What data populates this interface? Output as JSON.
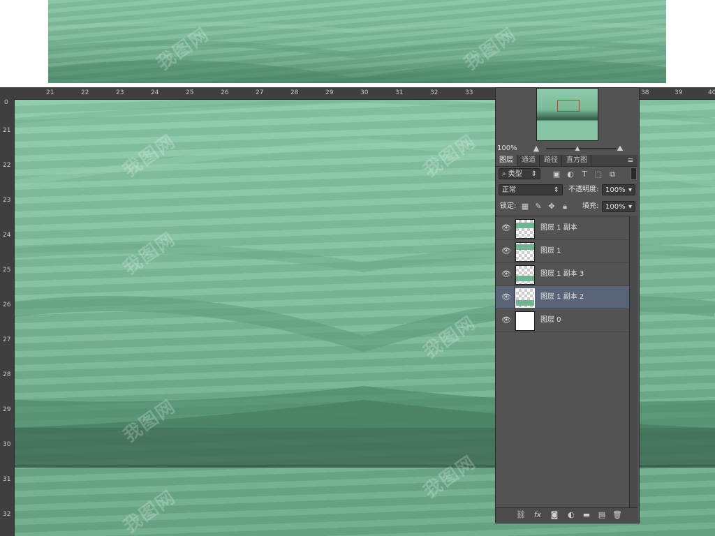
{
  "watermark": "我图网",
  "ruler": {
    "horizontal": [
      "21",
      "22",
      "23",
      "24",
      "25",
      "26",
      "27",
      "28",
      "29",
      "30",
      "31",
      "32",
      "33",
      "38",
      "39",
      "40"
    ],
    "vertical": [
      "0",
      "21",
      "22",
      "23",
      "24",
      "25",
      "26",
      "27",
      "28",
      "29",
      "30",
      "31",
      "32"
    ]
  },
  "navigator": {
    "zoom": "100%"
  },
  "layers_panel": {
    "tabs": [
      {
        "label": "图层",
        "active": true
      },
      {
        "label": "通道",
        "active": false
      },
      {
        "label": "路径",
        "active": false
      },
      {
        "label": "直方图",
        "active": false
      }
    ],
    "filter_kind": "类型",
    "blend_mode": "正常",
    "opacity_label": "不透明度:",
    "opacity_value": "100%",
    "lock_label": "锁定:",
    "fill_label": "填充:",
    "fill_value": "100%",
    "layers": [
      {
        "name": "图层 1 副本",
        "visible": true,
        "selected": false,
        "thumb": "green-top"
      },
      {
        "name": "图层 1",
        "visible": true,
        "selected": false,
        "thumb": "green-top"
      },
      {
        "name": "图层 1 副本 3",
        "visible": true,
        "selected": false,
        "thumb": "green-bottom"
      },
      {
        "name": "图层 1 副本 2",
        "visible": true,
        "selected": true,
        "thumb": "green-bottom"
      },
      {
        "name": "图层 0",
        "visible": true,
        "selected": false,
        "thumb": "white"
      }
    ],
    "footer_icons": [
      "link-icon",
      "fx-icon",
      "mask-icon",
      "adjustment-icon",
      "group-folder-icon",
      "new-layer-icon",
      "trash-icon"
    ]
  },
  "colors": {
    "canvas_green": "#7dbc9b",
    "dark_green": "#3f6b55",
    "panel_bg": "#535353",
    "selected_row": "#596478"
  }
}
